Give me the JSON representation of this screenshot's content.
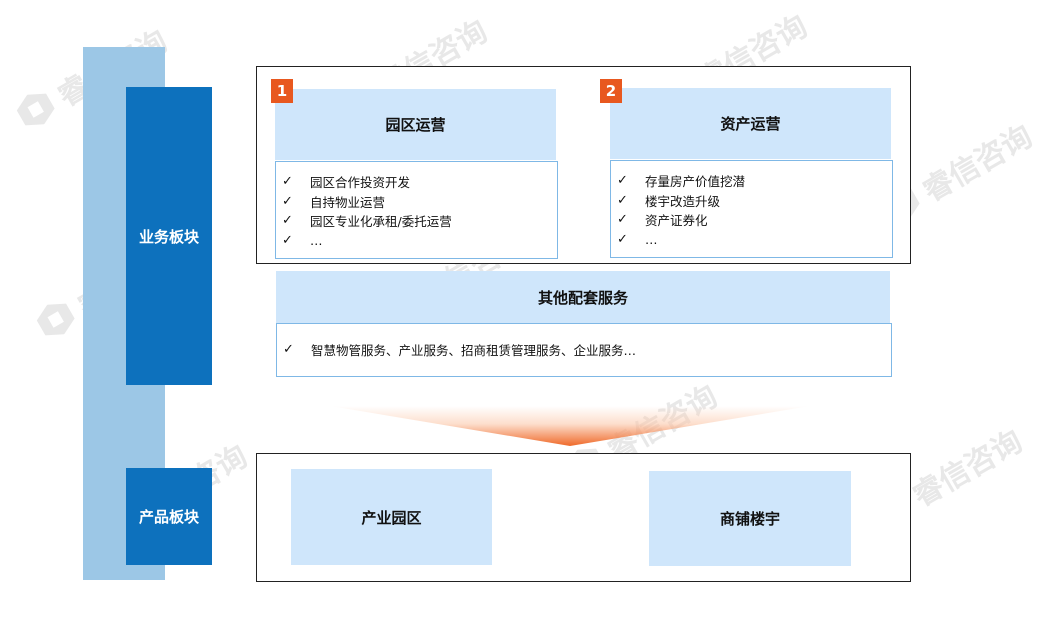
{
  "left_column": {
    "business_label": "业务板块",
    "product_label": "产品板块"
  },
  "business": {
    "park": {
      "badge": "1",
      "title": "园区运营",
      "items": [
        "园区合作投资开发",
        "自持物业运营",
        "园区专业化承租/委托运营",
        "…"
      ]
    },
    "asset": {
      "badge": "2",
      "title": "资产运营",
      "items": [
        "存量房产价值挖潜",
        "楼宇改造升级",
        "资产证券化",
        "…"
      ]
    },
    "other": {
      "title": "其他配套服务",
      "items": [
        "智慧物管服务、产业服务、招商租赁管理服务、企业服务…"
      ]
    }
  },
  "products": {
    "left": "产业园区",
    "right": "商铺楼宇"
  },
  "watermark": "睿信咨询",
  "colors": {
    "dark_blue": "#0d71bd",
    "light_blue_bar": "#9cc7e6",
    "header_fill": "#cfe6fb",
    "badge_orange": "#e8581f"
  }
}
